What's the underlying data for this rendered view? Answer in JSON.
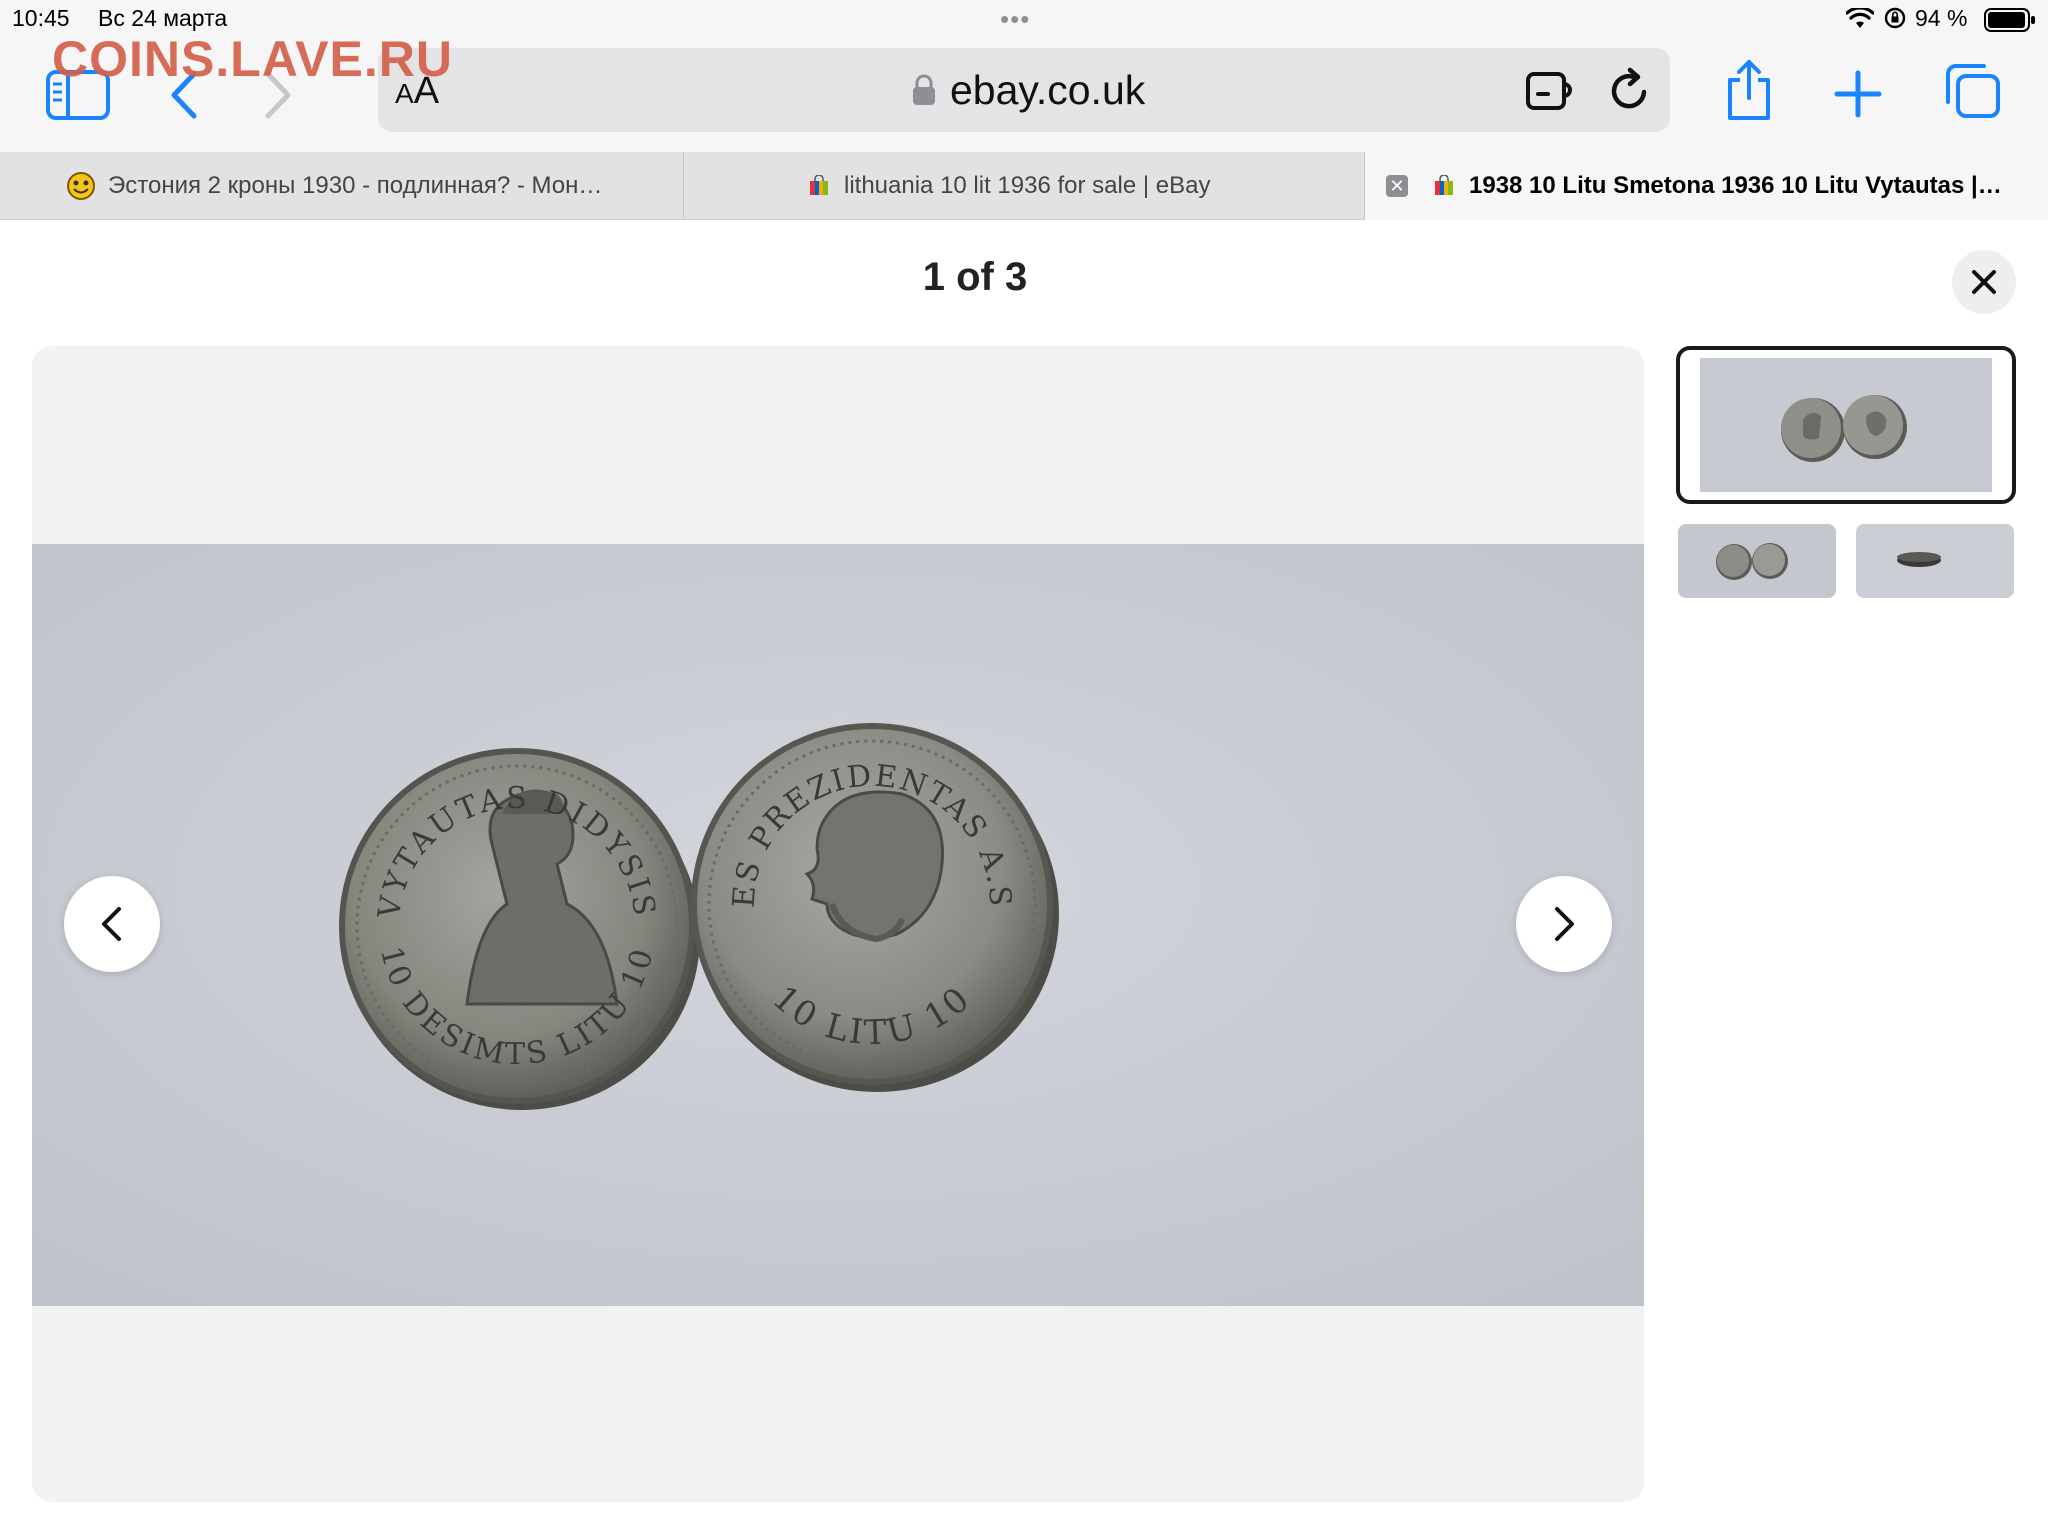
{
  "status_bar": {
    "time": "10:45",
    "date": "Вс 24 марта",
    "battery_text": "94 %"
  },
  "watermark": "COINS.LAVE.RU",
  "toolbar": {
    "text_size_label_small": "A",
    "text_size_label_large": "A",
    "url": "ebay.co.uk"
  },
  "tabs": [
    {
      "title": "Эстония 2 кроны 1930 - подлинная? - Мон…"
    },
    {
      "title": "lithuania 10 lit 1936 for sale | eBay"
    },
    {
      "title": "1938 10 Litu Smetona 1936 10 Litu Vytautas |…"
    }
  ],
  "viewer": {
    "counter": "1 of 3"
  },
  "coins": {
    "left": {
      "top_legend": "VYTAUTAS DIDYSIS",
      "bottom_legend": "10 DESIMTS LITU 10"
    },
    "right": {
      "top_legend": "VALSTYBES PREZIDENTAS A.SMETONA",
      "bottom_legend": "10 LITU 10"
    }
  },
  "colors": {
    "accent": "#1a84ff",
    "watermark": "#d4614a",
    "photo_bg": "#c9ccd2",
    "coin_silver": "#8c8c86"
  }
}
